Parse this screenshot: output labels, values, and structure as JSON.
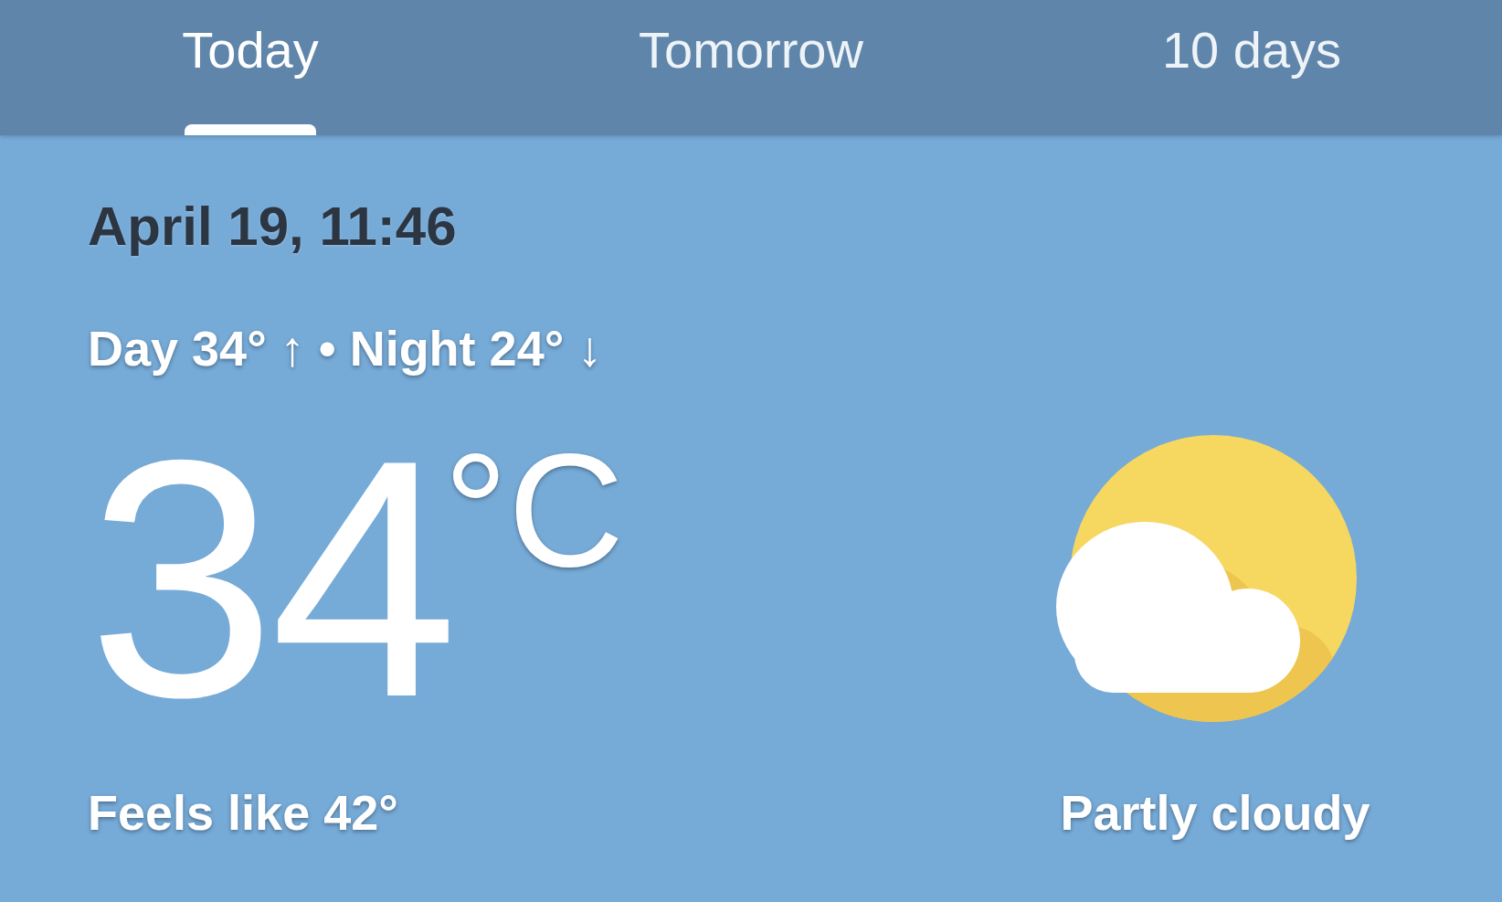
{
  "tabs": [
    {
      "label": "Today",
      "selected": true
    },
    {
      "label": "Tomorrow",
      "selected": false
    },
    {
      "label": "10 days",
      "selected": false
    }
  ],
  "current": {
    "datetime": "April 19, 11:46",
    "day_night": "Day 34° ↑ • Night 24° ↓",
    "temperature": "34",
    "unit": "°C",
    "feels_like": "Feels like 42°",
    "condition": {
      "kind": "partly_cloudy",
      "label": "Partly cloudy"
    }
  }
}
